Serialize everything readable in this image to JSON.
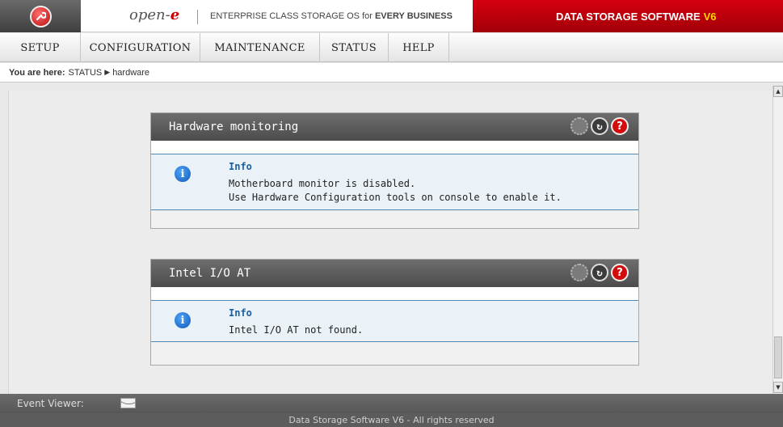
{
  "header": {
    "brand_text": "open-",
    "brand_e": "e",
    "tagline_prefix": "ENTERPRISE CLASS STORAGE OS for ",
    "tagline_bold": "EVERY BUSINESS",
    "product_name": "DATA STORAGE SOFTWARE",
    "product_version": "V6"
  },
  "menu": {
    "items": [
      {
        "label": "SETUP"
      },
      {
        "label": "CONFIGURATION"
      },
      {
        "label": "MAINTENANCE"
      },
      {
        "label": "STATUS"
      },
      {
        "label": "HELP"
      }
    ]
  },
  "breadcrumb": {
    "prefix": "You are here:",
    "section": "STATUS",
    "page": "hardware"
  },
  "panels": [
    {
      "title": "Hardware monitoring",
      "info_title": "Info",
      "lines": [
        "Motherboard monitor is disabled.",
        "Use Hardware Configuration tools on console to enable it."
      ]
    },
    {
      "title": "Intel I/O AT",
      "info_title": "Info",
      "lines": [
        "Intel I/O AT not found."
      ]
    }
  ],
  "icons": {
    "logo": "wrench-icon",
    "settings": "gear-icon",
    "refresh": "refresh-icon",
    "help": "help-icon",
    "info": "info-icon",
    "mail": "mail-icon"
  },
  "event_viewer": {
    "label": "Event Viewer:"
  },
  "footer": {
    "text": "Data Storage Software V6 - All rights reserved"
  },
  "colors": {
    "brand_red": "#c80000",
    "version_yellow": "#ffd800",
    "panel_header": "#5a5a5a",
    "info_blue": "#1d5ea0"
  }
}
